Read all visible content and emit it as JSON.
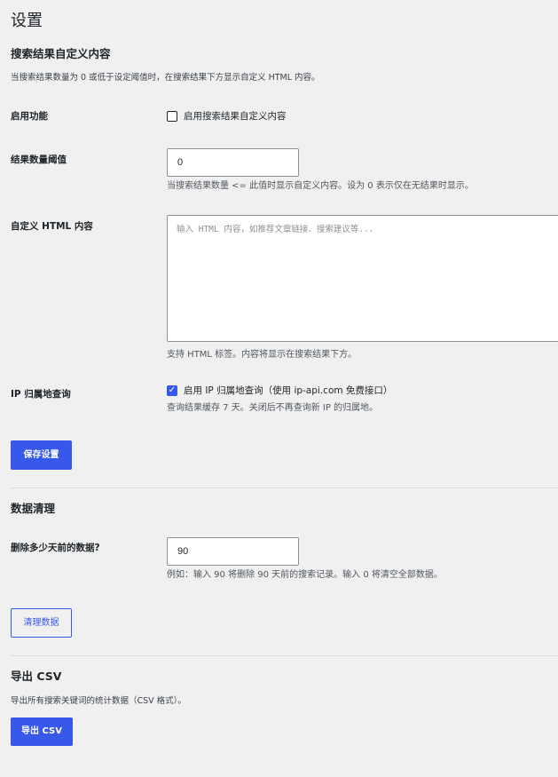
{
  "page": {
    "title": "设置"
  },
  "search_custom": {
    "heading": "搜索结果自定义内容",
    "description": "当搜索结果数量为 0 或低于设定阈值时，在搜索结果下方显示自定义 HTML 内容。",
    "enable": {
      "label": "启用功能",
      "checkbox_label": "启用搜索结果自定义内容",
      "checked": false
    },
    "threshold": {
      "label": "结果数量阈值",
      "value": "0",
      "hint": "当搜索结果数量 <= 此值时显示自定义内容。设为 0 表示仅在无结果时显示。"
    },
    "custom_html": {
      "label": "自定义 HTML 内容",
      "placeholder": "输入 HTML 内容，如推荐文章链接、搜索建议等...",
      "hint": "支持 HTML 标签。内容将显示在搜索结果下方。"
    },
    "ip_lookup": {
      "label": "IP 归属地查询",
      "checkbox_label": "启用 IP 归属地查询（使用 ip-api.com 免费接口）",
      "checked": true,
      "hint": "查询结果缓存 7 天。关闭后不再查询新 IP 的归属地。"
    },
    "save_button": "保存设置"
  },
  "cleanup": {
    "heading": "数据清理",
    "days": {
      "label": "删除多少天前的数据?",
      "value": "90",
      "hint": "例如：输入 90 将删除 90 天前的搜索记录。输入 0 将清空全部数据。"
    },
    "clean_button": "清理数据"
  },
  "export": {
    "heading": "导出 CSV",
    "description": "导出所有搜索关键词的统计数据（CSV 格式）。",
    "export_button": "导出 CSV"
  },
  "colors": {
    "accent": "#3858e9",
    "background": "#f0f0f1",
    "text": "#1d2327"
  }
}
